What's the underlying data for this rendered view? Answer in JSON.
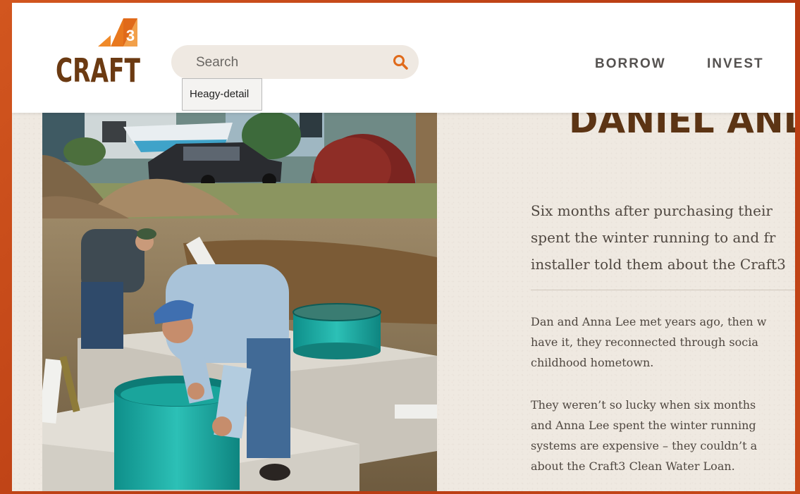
{
  "header": {
    "logo_text": "CRAFT",
    "logo_number": "3",
    "search": {
      "placeholder": "Search"
    },
    "tooltip": "Heagy-detail",
    "nav": [
      {
        "label": "BORROW"
      },
      {
        "label": "INVEST"
      }
    ]
  },
  "story": {
    "headline": "DANIEL AND",
    "lead_lines": [
      "Six months after purchasing their",
      "spent the winter running to and fr",
      "installer told them about the Craft3"
    ],
    "paragraph1_lines": [
      "Dan and Anna Lee met years ago, then w",
      "have it, they reconnected through socia",
      "childhood hometown."
    ],
    "paragraph2_lines": [
      "They weren’t so lucky when six months",
      "and Anna Lee spent the winter running",
      "systems are expensive – they couldn’t a",
      "about the Craft3 Clean Water Loan."
    ]
  },
  "colors": {
    "brand_orange": "#e8781e",
    "brand_brown": "#6b3a12",
    "frame": "#c8471a",
    "search_icon": "#e06a1a"
  }
}
